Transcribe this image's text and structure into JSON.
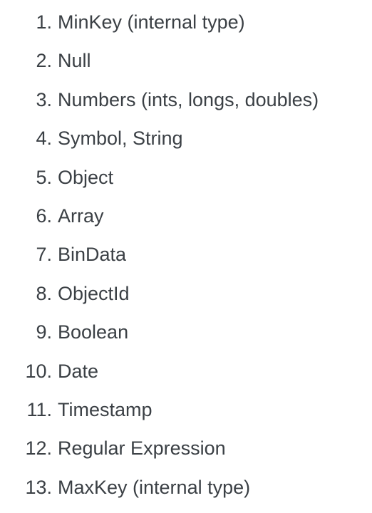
{
  "list": {
    "items": [
      {
        "number": "1.",
        "label": "MinKey (internal type)"
      },
      {
        "number": "2.",
        "label": "Null"
      },
      {
        "number": "3.",
        "label": "Numbers (ints, longs, doubles)"
      },
      {
        "number": "4.",
        "label": "Symbol, String"
      },
      {
        "number": "5.",
        "label": "Object"
      },
      {
        "number": "6.",
        "label": "Array"
      },
      {
        "number": "7.",
        "label": "BinData"
      },
      {
        "number": "8.",
        "label": "ObjectId"
      },
      {
        "number": "9.",
        "label": "Boolean"
      },
      {
        "number": "10.",
        "label": "Date"
      },
      {
        "number": "11.",
        "label": "Timestamp"
      },
      {
        "number": "12.",
        "label": "Regular Expression"
      },
      {
        "number": "13.",
        "label": "MaxKey (internal type)"
      }
    ]
  }
}
